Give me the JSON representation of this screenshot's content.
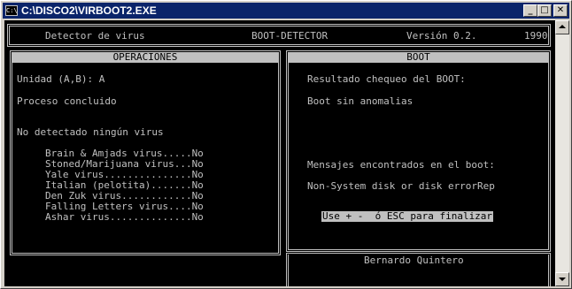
{
  "window": {
    "title": "C:\\DISCO2\\VIRBOOT2.EXE",
    "icon_text": "C:\\",
    "minimize_glyph": "_",
    "maximize_glyph": "□",
    "close_glyph": "✕"
  },
  "header": {
    "left": "Detector de virus",
    "center": "BOOT-DETECTOR",
    "version": "Versión 0.2.",
    "year": "1990"
  },
  "operaciones": {
    "title": "OPERACIONES",
    "unidad": "Unidad (A,B): A",
    "proceso": "Proceso concluido",
    "resultado": "No detectado ningún virus",
    "viruses": [
      "Brain & Amjads virus.....No",
      "Stoned/Marijuana virus...No",
      "Yale virus...............No",
      "Italian (pelotita).......No",
      "Den Zuk virus............No",
      "Falling Letters virus....No",
      "Ashar virus..............No"
    ]
  },
  "boot": {
    "title": "BOOT",
    "resultado_label": "Resultado chequeo del BOOT:",
    "resultado_value": "Boot sin anomalias",
    "mensajes_label": "Mensajes encontrados en el boot:",
    "mensaje": "Non-System disk or disk errorRep",
    "hint": "Use + -  ó ESC para finalizar"
  },
  "footer": {
    "author": "Bernardo Quintero"
  }
}
